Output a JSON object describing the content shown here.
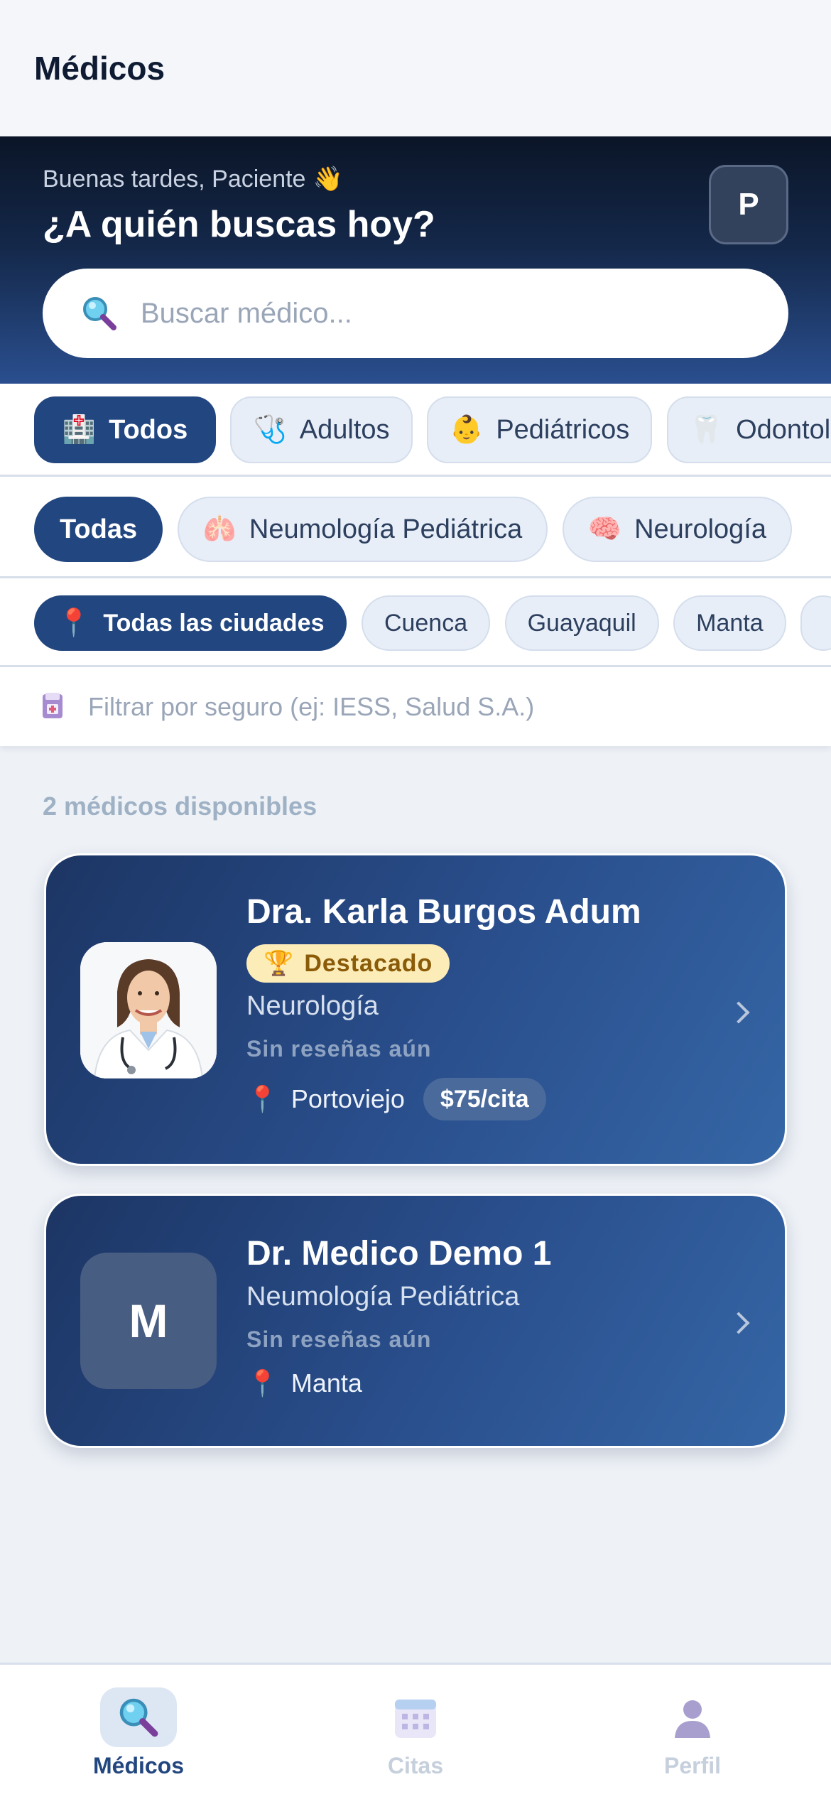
{
  "header": {
    "title": "Médicos"
  },
  "hero": {
    "greeting": "Buenas tardes, Paciente",
    "greeting_emoji": "👋",
    "question": "¿A quién buscas hoy?",
    "avatar_initial": "P"
  },
  "search": {
    "placeholder": "Buscar médico..."
  },
  "categories": [
    {
      "emoji": "🏥",
      "label": "Todos",
      "active": true
    },
    {
      "emoji": "🩺",
      "label": "Adultos",
      "active": false
    },
    {
      "emoji": "👶",
      "label": "Pediátricos",
      "active": false
    },
    {
      "emoji": "🦷",
      "label": "Odontológicos",
      "active": false
    }
  ],
  "specialties": [
    {
      "emoji": "",
      "label": "Todas",
      "active": true
    },
    {
      "emoji": "🫁",
      "label": "Neumología Pediátrica",
      "active": false
    },
    {
      "emoji": "🧠",
      "label": "Neurología",
      "active": false
    }
  ],
  "cities": [
    {
      "emoji": "📍",
      "label": "Todas las ciudades",
      "active": true
    },
    {
      "emoji": "",
      "label": "Cuenca",
      "active": false
    },
    {
      "emoji": "",
      "label": "Guayaquil",
      "active": false
    },
    {
      "emoji": "",
      "label": "Manta",
      "active": false
    }
  ],
  "insurance": {
    "placeholder": "Filtrar por seguro (ej: IESS, Salud S.A.)"
  },
  "results": {
    "count_text": "2 médicos disponibles"
  },
  "doctors": [
    {
      "name": "Dra. Karla Burgos Adum",
      "badge": "Destacado",
      "specialty": "Neurología",
      "reviews": "Sin reseñas aún",
      "city": "Portoviejo",
      "price": "$75/cita"
    },
    {
      "name": "Dr. Medico Demo 1",
      "initial": "M",
      "specialty": "Neumología Pediátrica",
      "reviews": "Sin reseñas aún",
      "city": "Manta"
    }
  ],
  "tabs": [
    {
      "label": "Médicos",
      "icon": "magnifier-icon",
      "active": true
    },
    {
      "label": "Citas",
      "icon": "calendar-icon",
      "active": false
    },
    {
      "label": "Perfil",
      "icon": "person-icon",
      "active": false
    }
  ],
  "colors": {
    "primary": "#22467f",
    "hero_dark": "#0b1527",
    "badge_bg": "#fcecb8",
    "badge_text": "#8a5b09"
  }
}
